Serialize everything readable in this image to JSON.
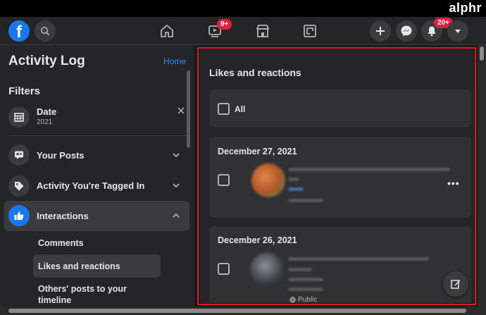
{
  "brand": "alphr",
  "header": {
    "logo_letter": "f",
    "watch_badge": "9+",
    "notifications_badge": "20+",
    "icons": [
      "facebook-logo-icon",
      "search-icon",
      "home-icon",
      "watch-icon",
      "marketplace-icon",
      "gaming-icon",
      "plus-icon",
      "messenger-icon",
      "bell-icon",
      "caret-down-icon"
    ]
  },
  "sidebar": {
    "title": "Activity Log",
    "home_link": "Home",
    "filters_heading": "Filters",
    "date_filter": {
      "label": "Date",
      "value": "2021"
    },
    "categories": [
      {
        "label": "Your Posts"
      },
      {
        "label": "Activity You're Tagged In"
      },
      {
        "label": "Interactions"
      }
    ],
    "sub_items": [
      {
        "label": "Comments"
      },
      {
        "label": "Likes and reactions"
      },
      {
        "label": "Others' posts to your timeline"
      }
    ]
  },
  "main": {
    "section_title": "Likes and reactions",
    "select_all_label": "All",
    "entries": [
      {
        "date": "December 27, 2021"
      },
      {
        "date": "December 26, 2021",
        "privacy": "Public"
      }
    ],
    "more_label": "•••"
  },
  "colors": {
    "accent": "#1877f2",
    "link": "#2d88ff",
    "badge": "#e41e3f",
    "highlight_border": "#e0162b",
    "background": "#18191a",
    "surface": "#242526"
  }
}
